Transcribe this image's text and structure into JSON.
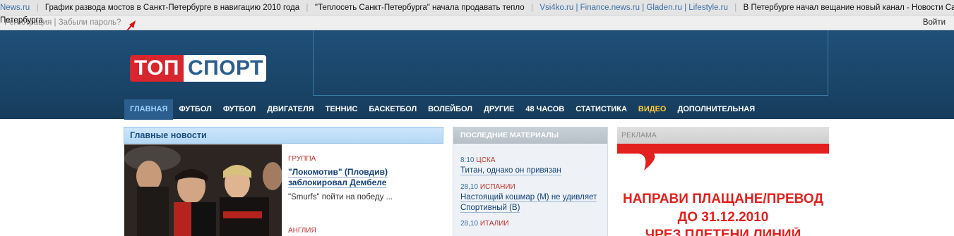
{
  "ticker": {
    "items": [
      {
        "src": "News.ru",
        "text": "График развода мостов в Санкт-Петербурге в навигацию 2010 года"
      },
      {
        "src": "",
        "text": "\"Теплосеть Санкт-Петербурга\" начала продавать тепло"
      },
      {
        "src": "Vsi4ko.ru | Finance.news.ru | Gladen.ru | Lifestyle.ru",
        "text": "В Петербурге начал вещание новый канал - Новости Санкт-Петербурга"
      }
    ]
  },
  "loginbar": {
    "register": "Регистрация",
    "forgot": "Забыли пароль?",
    "spill": "Петербурга",
    "login": "Войти"
  },
  "logo": {
    "part1": "ТОП",
    "part2": "СПОРТ"
  },
  "nav": [
    "ГЛАВНАЯ",
    "ФУТБОЛ",
    "ФУТБОЛ",
    "ДВИГАТЕЛЯ",
    "ТЕННИС",
    "БАСКЕТБОЛ",
    "ВОЛЕЙБОЛ",
    "ДРУГИЕ",
    "48 ЧАСОВ",
    "СТАТИСТИКА",
    "ВИДЕО",
    "ДОПОЛНИТЕЛЬНАЯ"
  ],
  "main_news": {
    "heading": "Главные новости",
    "items": [
      {
        "category": "ГРУППА",
        "title": "\"Локомотив\" (Пловдив) заблокировал Дембеле",
        "sub": "\"Smurfs\" пойти на победу ..."
      },
      {
        "category": "АНГЛИЯ",
        "title": "",
        "sub": ""
      }
    ]
  },
  "latest": {
    "heading": "ПОСЛЕДНИЕ МАТЕРИАЛЫ",
    "items": [
      {
        "time": "8:10",
        "tag": "ЦСКА",
        "title": "Титан, однако он привязан"
      },
      {
        "time": "28,10",
        "tag": "ИСПАНИИ",
        "title": "Настоящий кошмар (М) не удивляет Спортивный (В)"
      },
      {
        "time": "28,10",
        "tag": "ИТАЛИИ",
        "title": ""
      }
    ]
  },
  "ad": {
    "heading": "РЕКЛАМА",
    "line1": "НАПРАВИ ПЛАЩАНЕ/ПРЕВОД",
    "line2": "ДО 31.12.2010",
    "line3": "ЧРЕЗ ПЛЕТЕНИ ЛИНИЙ"
  },
  "colors": {
    "header": "#1a4569",
    "accent_red": "#d7262e",
    "video": "#ffcc33"
  }
}
